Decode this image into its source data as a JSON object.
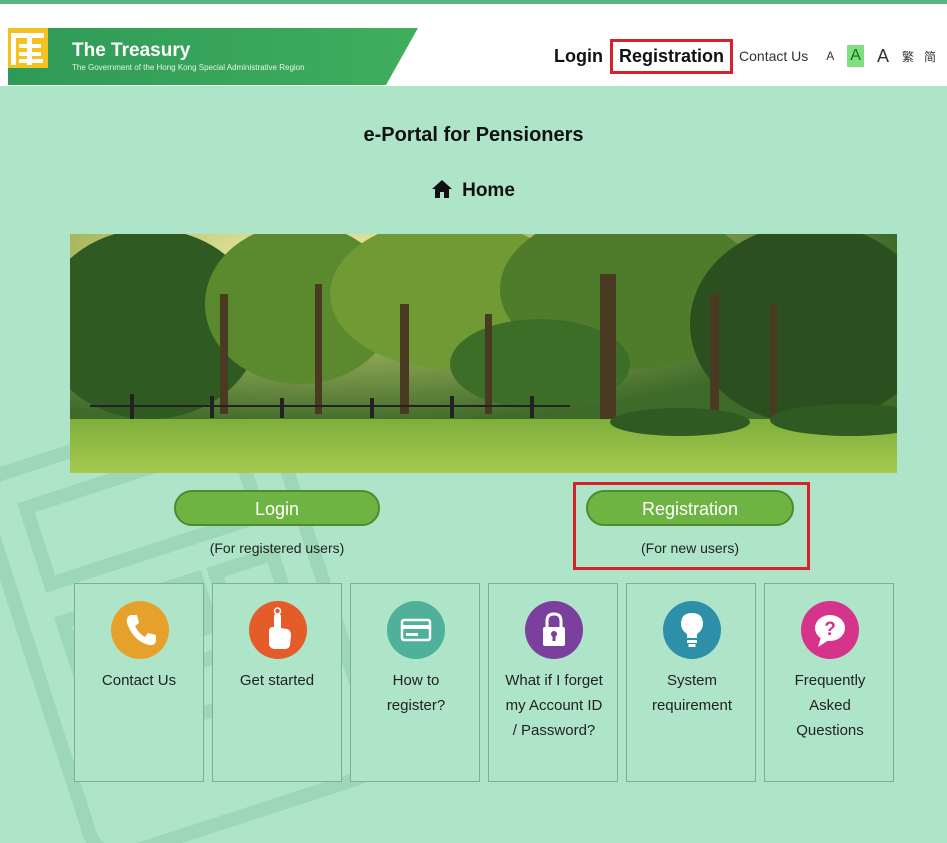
{
  "header": {
    "org_name": "The Treasury",
    "org_subtitle": "The Government of the Hong Kong Special Administrative Region",
    "nav": {
      "login": "Login",
      "registration": "Registration",
      "contact": "Contact Us",
      "font_small": "A",
      "font_medium": "A",
      "font_large": "A",
      "lang_trad": "繁",
      "lang_simp": "简"
    }
  },
  "page": {
    "title": "e-Portal for Pensioners",
    "breadcrumb": "Home"
  },
  "actions": {
    "login": {
      "label": "Login",
      "caption": "(For registered users)"
    },
    "registration": {
      "label": "Registration",
      "caption": "(For new users)"
    }
  },
  "tiles": [
    {
      "label": "Contact Us",
      "icon": "phone-icon",
      "color": "#e5a12b"
    },
    {
      "label": "Get started",
      "icon": "pointer-hand-icon",
      "color": "#e35c2a"
    },
    {
      "label": "How to register?",
      "icon": "card-icon",
      "color": "#4fb199"
    },
    {
      "label": "What if I forget my Account ID / Password?",
      "icon": "lock-icon",
      "color": "#7b3f9e"
    },
    {
      "label": "System requirement",
      "icon": "lightbulb-icon",
      "color": "#2d8fa8"
    },
    {
      "label": "Frequently Asked Questions",
      "icon": "question-icon",
      "color": "#d6338a"
    }
  ],
  "colors": {
    "page_bg": "#aee5c8",
    "brand_green": "#3a9a58",
    "button_green": "#6eb443",
    "highlight_red": "#d4232a"
  }
}
